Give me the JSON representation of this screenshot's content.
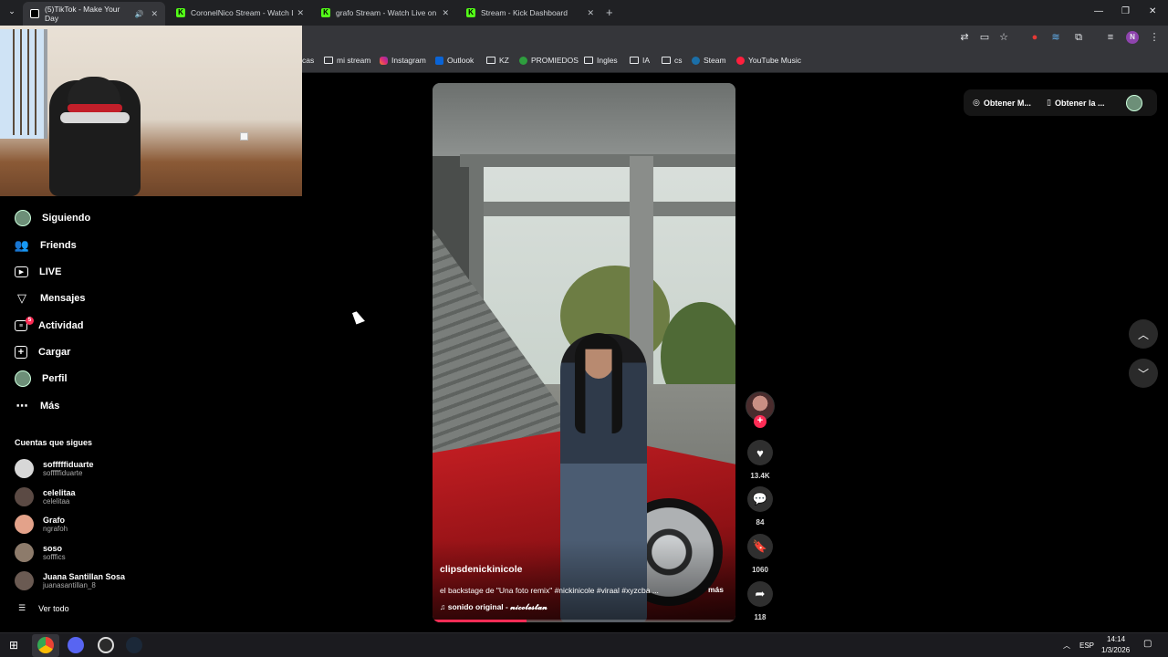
{
  "browser": {
    "tabs": [
      {
        "label": "(5)TikTok - Make Your Day",
        "active": true
      },
      {
        "label": "CoronelNico Stream - Watch Li"
      },
      {
        "label": "grafo Stream - Watch Live on K"
      },
      {
        "label": "Stream - Kick Dashboard"
      }
    ],
    "bookmarks": [
      {
        "label": "cas"
      },
      {
        "label": "mi stream"
      },
      {
        "label": "Instagram"
      },
      {
        "label": "Outlook"
      },
      {
        "label": "KZ"
      },
      {
        "label": "PROMIEDOS"
      },
      {
        "label": "Ingles"
      },
      {
        "label": "IA"
      },
      {
        "label": "cs"
      },
      {
        "label": "Steam"
      },
      {
        "label": "YouTube Music"
      }
    ],
    "profile_initial": "N"
  },
  "sidebar": {
    "nav": [
      {
        "label": "Siguiendo",
        "icon": "following-avatar-icon"
      },
      {
        "label": "Friends",
        "icon": "friends-icon"
      },
      {
        "label": "LIVE",
        "icon": "live-icon"
      },
      {
        "label": "Mensajes",
        "icon": "send-icon"
      },
      {
        "label": "Actividad",
        "icon": "activity-icon"
      },
      {
        "label": "Cargar",
        "icon": "upload-icon"
      },
      {
        "label": "Perfil",
        "icon": "profile-avatar-icon"
      },
      {
        "label": "Más",
        "icon": "more-icon"
      }
    ],
    "activity_badge": "5",
    "following_title": "Cuentas que sigues",
    "following": [
      {
        "name": "sofffffiduarte",
        "handle": "sofffffiduarte"
      },
      {
        "name": "celelitaa",
        "handle": "celelitaa"
      },
      {
        "name": "Grafo",
        "handle": "ngrafoh"
      },
      {
        "name": "soso",
        "handle": "sofffics"
      },
      {
        "name": "Juana Santillan Sosa",
        "handle": "juanasantillan_8"
      }
    ],
    "see_all": "Ver todo"
  },
  "video": {
    "author": "clipsdenickinicole",
    "description": "el backstage de \"Una foto remix\" #nickinicole #viraal #xyzcba ...",
    "more": "más",
    "sound": "sonido original - 𝓷𝓲𝓬𝓸𝓵𝓮𝓼𝓽𝓪𝓷",
    "progress": 0.31
  },
  "actions": {
    "likes": "13.4K",
    "comments": "84",
    "saves": "1060",
    "shares": "118"
  },
  "top_right": {
    "get_coins": "Obtener M...",
    "get_app": "Obtener la ..."
  },
  "taskbar": {
    "lang": "ESP",
    "time": "14:14",
    "date": "1/3/2026"
  },
  "colors": {
    "accent": "#fe2c55",
    "kick": "#53fc18",
    "chrome_bg": "#35363a"
  }
}
